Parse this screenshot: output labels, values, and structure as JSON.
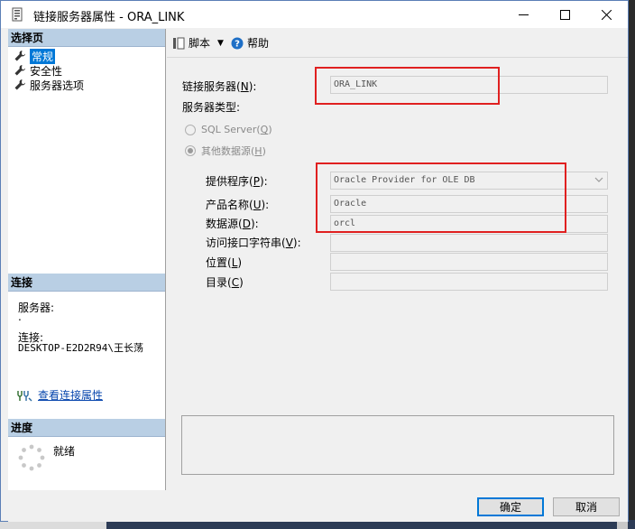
{
  "window": {
    "title": "链接服务器属性 - ORA_LINK"
  },
  "background": {
    "fragment": "4"
  },
  "sidebar": {
    "pages_header": "选择页",
    "pages": [
      {
        "label": "常规",
        "selected": true
      },
      {
        "label": "安全性",
        "selected": false
      },
      {
        "label": "服务器选项",
        "selected": false
      }
    ],
    "connection_header": "连接",
    "server_label": "服务器:",
    "server_value": ".",
    "connection_label": "连接:",
    "connection_value": "DESKTOP-E2D2R94\\王长荡",
    "view_conn_props_link": "查看连接属性",
    "progress_header": "进度",
    "progress_status": "就绪"
  },
  "toolbar": {
    "script_label": "脚本",
    "help_label": "帮助"
  },
  "form": {
    "linked_server_label": "链接服务器",
    "linked_server_key": "N",
    "linked_server_value": "ORA_LINK",
    "server_type_label": "服务器类型:",
    "radio_sql_server": "SQL Server",
    "radio_sql_server_key": "Q",
    "radio_other_source": "其他数据源",
    "radio_other_source_key": "H",
    "provider_label": "提供程序",
    "provider_key": "P",
    "provider_value": "Oracle Provider for OLE DB",
    "product_name_label": "产品名称",
    "product_name_key": "U",
    "product_name_value": "Oracle",
    "data_source_label": "数据源",
    "data_source_key": "D",
    "data_source_value": "orcl",
    "provider_string_label": "访问接口字符串",
    "provider_string_key": "V",
    "provider_string_value": "",
    "location_label": "位置",
    "location_key": "L",
    "location_value": "",
    "catalog_label": "目录",
    "catalog_key": "C",
    "catalog_value": ""
  },
  "buttons": {
    "ok": "确定",
    "cancel": "取消"
  },
  "colors": {
    "accent": "#0078d7",
    "section_header": "#b9cfe4",
    "highlight_box": "#e02020"
  }
}
